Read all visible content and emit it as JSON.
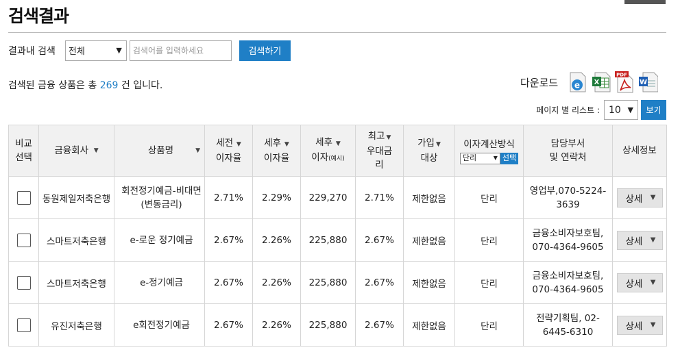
{
  "page": {
    "title": "검색결과"
  },
  "search": {
    "label": "결과내 검색",
    "scope": "전체",
    "placeholder": "검색어를 입력하세요",
    "button": "검색하기"
  },
  "summary": {
    "prefix": "검색된 금융 상품은 총 ",
    "count": "269",
    "suffix": " 건 입니다."
  },
  "download": {
    "label": "다운로드",
    "icons": [
      "ie-icon",
      "excel-icon",
      "pdf-icon",
      "word-icon"
    ]
  },
  "pagesize": {
    "label": "페이지 별 리스트 :",
    "value": "10",
    "button": "보기"
  },
  "table": {
    "headers": {
      "compare_1": "비교",
      "compare_2": "선택",
      "company": "금융회사",
      "product": "상품명",
      "pretax_1": "세전",
      "pretax_2": "이자율",
      "aftertax_1": "세후",
      "aftertax_2": "이자율",
      "interest_1": "세후",
      "interest_2": "이자",
      "interest_note": "(예시)",
      "maxrate_1": "최고",
      "maxrate_2": "우대금",
      "maxrate_3": "리",
      "join_1": "가입",
      "join_2": "대상",
      "calc_title": "이자계산방식",
      "calc_select": "단리",
      "calc_button": "선택",
      "contact_1": "담당부서",
      "contact_2": "및 연락처",
      "detail": "상세정보"
    },
    "rows": [
      {
        "company": "동원제일저축은행",
        "product_1": "회전정기예금-비대면",
        "product_2": "(변동금리)",
        "pretax": "2.71%",
        "aftertax": "2.29%",
        "interest": "229,270",
        "maxrate": "2.71%",
        "join": "제한없음",
        "calc": "단리",
        "contact_1": "영업부,070-5224-",
        "contact_2": "3639",
        "detail": "상세"
      },
      {
        "company": "스마트저축은행",
        "product_1": "e-로운 정기예금",
        "product_2": "",
        "pretax": "2.67%",
        "aftertax": "2.26%",
        "interest": "225,880",
        "maxrate": "2.67%",
        "join": "제한없음",
        "calc": "단리",
        "contact_1": "금융소비자보호팀,",
        "contact_2": "070-4364-9605",
        "detail": "상세"
      },
      {
        "company": "스마트저축은행",
        "product_1": "e-정기예금",
        "product_2": "",
        "pretax": "2.67%",
        "aftertax": "2.26%",
        "interest": "225,880",
        "maxrate": "2.67%",
        "join": "제한없음",
        "calc": "단리",
        "contact_1": "금융소비자보호팀,",
        "contact_2": "070-4364-9605",
        "detail": "상세"
      },
      {
        "company": "유진저축은행",
        "product_1": "e회전정기예금",
        "product_2": "",
        "pretax": "2.67%",
        "aftertax": "2.26%",
        "interest": "225,880",
        "maxrate": "2.67%",
        "join": "제한없음",
        "calc": "단리",
        "contact_1": "전략기획팀, 02-",
        "contact_2": "6445-6310",
        "detail": "상세"
      }
    ]
  }
}
